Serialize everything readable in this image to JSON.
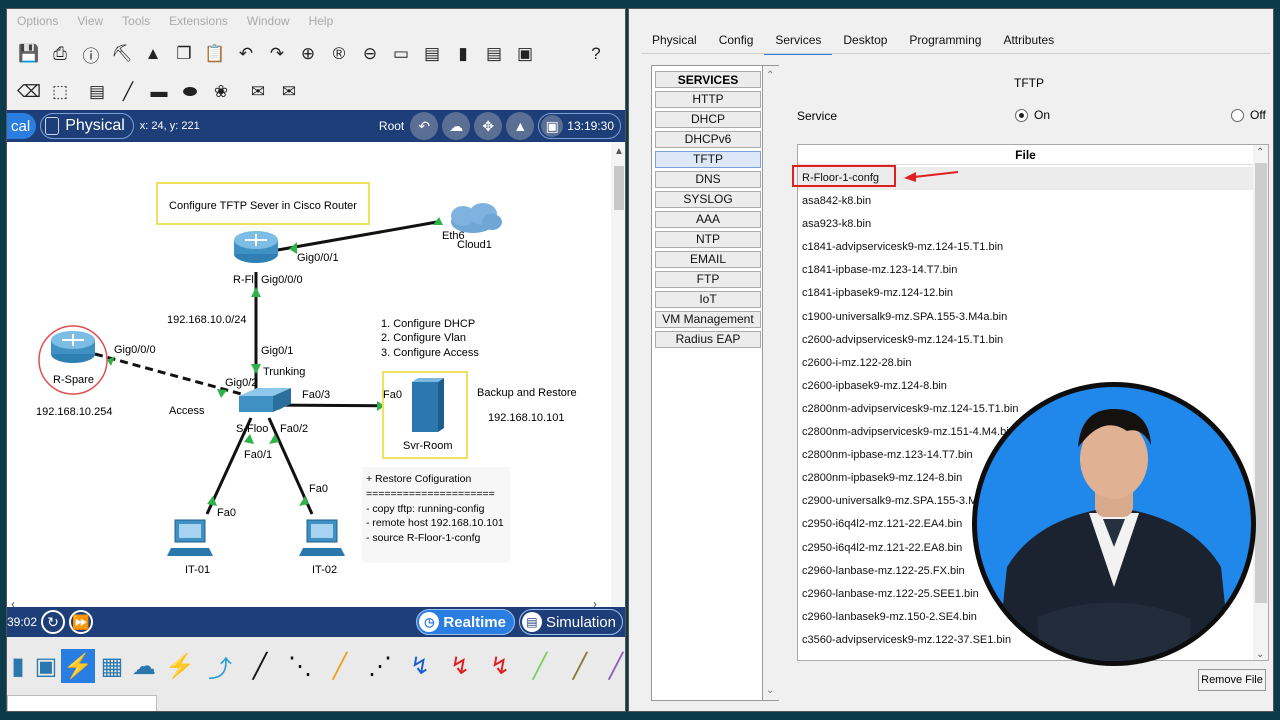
{
  "menubar": [
    "Options",
    "View",
    "Tools",
    "Extensions",
    "Window",
    "Help"
  ],
  "topobar": {
    "logical_label": "cal",
    "physical_label": "Physical",
    "coords": "x: 24, y: 221",
    "root_label": "Root",
    "clock": "13:19:30"
  },
  "canvas": {
    "title_note": "Configure TFTP Sever in Cisco Router",
    "router_main_name": "R-Fl",
    "router_main_gig000": "Gig0/0/0",
    "router_main_gig001": "Gig0/0/1",
    "cloud_name": "Cloud1",
    "cloud_eth": "Eth6",
    "net_label": "192.168.10.0/24",
    "router_spare_name": "R-Spare",
    "router_spare_gig": "Gig0/0/0",
    "router_spare_ip": "192.168.10.254",
    "switch_name": "S-Floo",
    "sw_gig01": "Gig0/1",
    "sw_gig02": "Gig0/2",
    "sw_fa03": "Fa0/3",
    "sw_fa02": "Fa0/2",
    "sw_fa01": "Fa0/1",
    "trunking": "Trunking",
    "access": "Access",
    "tasks": [
      "1. Configure DHCP",
      "2. Configure Vlan",
      "3. Configure Access"
    ],
    "server_name": "Svr-Room",
    "server_fa0": "Fa0",
    "backup_label": "Backup and Restore",
    "server_ip": "192.168.10.101",
    "pc1_name": "IT-01",
    "pc1_fa0": "Fa0",
    "pc2_name": "IT-02",
    "pc2_fa0": "Fa0",
    "restore_note": [
      "+ Restore Cofiguration",
      "=====================",
      "- copy tftp: running-config",
      "- remote host 192.168.10.101",
      "- source R-Floor-1-confg"
    ]
  },
  "bottombar": {
    "time": "39:02",
    "realtime_label": "Realtime",
    "simulation_label": "Simulation"
  },
  "right": {
    "tabs": [
      "Physical",
      "Config",
      "Services",
      "Desktop",
      "Programming",
      "Attributes"
    ],
    "active_tab": "Services",
    "services_header": "SERVICES",
    "services": [
      "HTTP",
      "DHCP",
      "DHCPv6",
      "TFTP",
      "DNS",
      "SYSLOG",
      "AAA",
      "NTP",
      "EMAIL",
      "FTP",
      "IoT",
      "VM Management",
      "Radius EAP"
    ],
    "active_service": "TFTP",
    "panel_title": "TFTP",
    "service_label": "Service",
    "on_label": "On",
    "off_label": "Off",
    "service_state": "On",
    "file_header": "File",
    "files": [
      "R-Floor-1-confg",
      "asa842-k8.bin",
      "asa923-k8.bin",
      "c1841-advipservicesk9-mz.124-15.T1.bin",
      "c1841-ipbase-mz.123-14.T7.bin",
      "c1841-ipbasek9-mz.124-12.bin",
      "c1900-universalk9-mz.SPA.155-3.M4a.bin",
      "c2600-advipservicesk9-mz.124-15.T1.bin",
      "c2600-i-mz.122-28.bin",
      "c2600-ipbasek9-mz.124-8.bin",
      "c2800nm-advipservicesk9-mz.124-15.T1.bin",
      "c2800nm-advipservicesk9-mz.151-4.M4.bin",
      "c2800nm-ipbase-mz.123-14.T7.bin",
      "c2800nm-ipbasek9-mz.124-8.bin",
      "c2900-universalk9-mz.SPA.155-3.M4a.bin",
      "c2950-i6q4l2-mz.121-22.EA4.bin",
      "c2950-i6q4l2-mz.121-22.EA8.bin",
      "c2960-lanbase-mz.122-25.FX.bin",
      "c2960-lanbase-mz.122-25.SEE1.bin",
      "c2960-lanbasek9-mz.150-2.SE4.bin",
      "c3560-advipservicesk9-mz.122-37.SE1.bin"
    ],
    "remove_button": "Remove File"
  },
  "colors": {
    "topobar": "#1d3e78",
    "accent": "#2a7de1",
    "highlight": "#e02020",
    "note_border": "#f0e060"
  }
}
